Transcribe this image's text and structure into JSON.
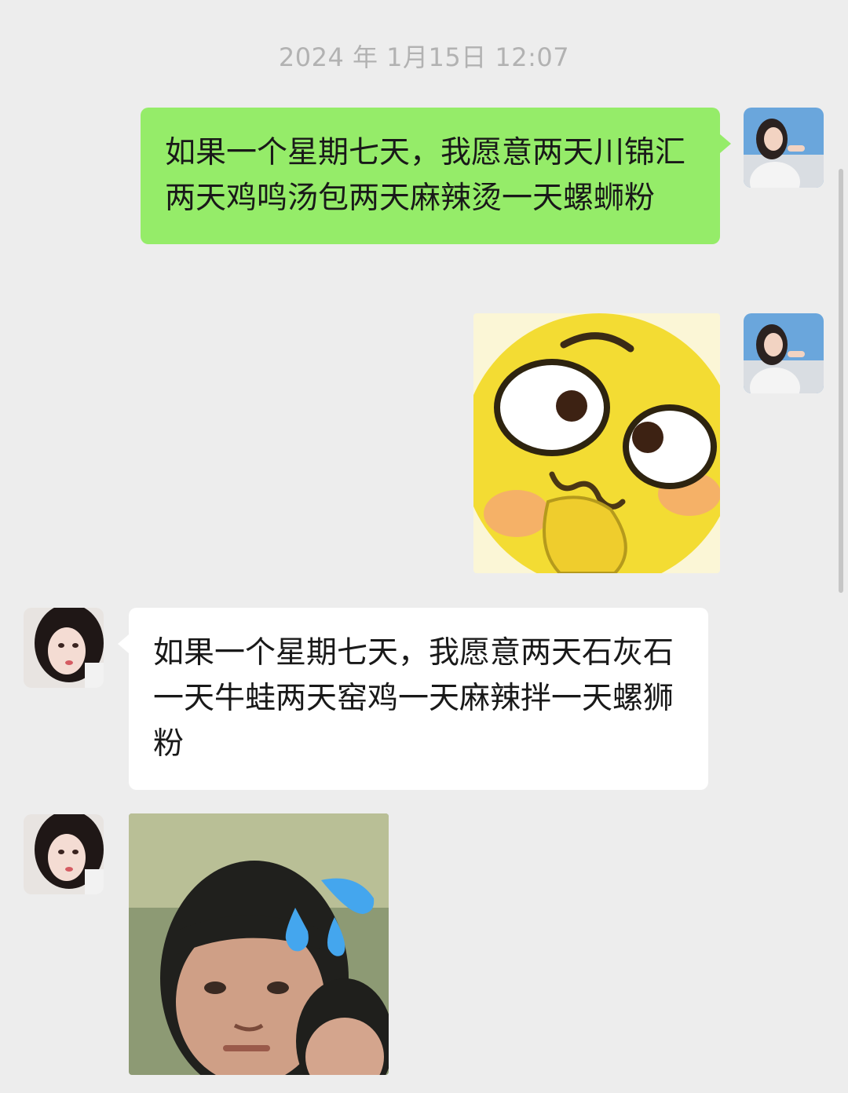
{
  "chat": {
    "timestamp": "2024 年 1月15日 12:07",
    "messages": [
      {
        "type": "text",
        "direction": "sent",
        "text": "如果一个星期七天，我愿意两天川锦汇两天鸡鸣汤包两天麻辣烫一天螺蛳粉"
      },
      {
        "type": "sticker",
        "direction": "sent",
        "icon": "shy-emoji-sticker"
      },
      {
        "type": "text",
        "direction": "received",
        "text": "如果一个星期七天，我愿意两天石灰石一天牛蛙两天窑鸡一天麻辣拌一天螺狮粉"
      },
      {
        "type": "sticker",
        "direction": "received",
        "icon": "sweating-boy-sticker"
      }
    ]
  },
  "colors": {
    "background": "#ededed",
    "sent_bubble": "#95ec69",
    "received_bubble": "#ffffff",
    "timestamp_text": "#b2b2b2"
  }
}
